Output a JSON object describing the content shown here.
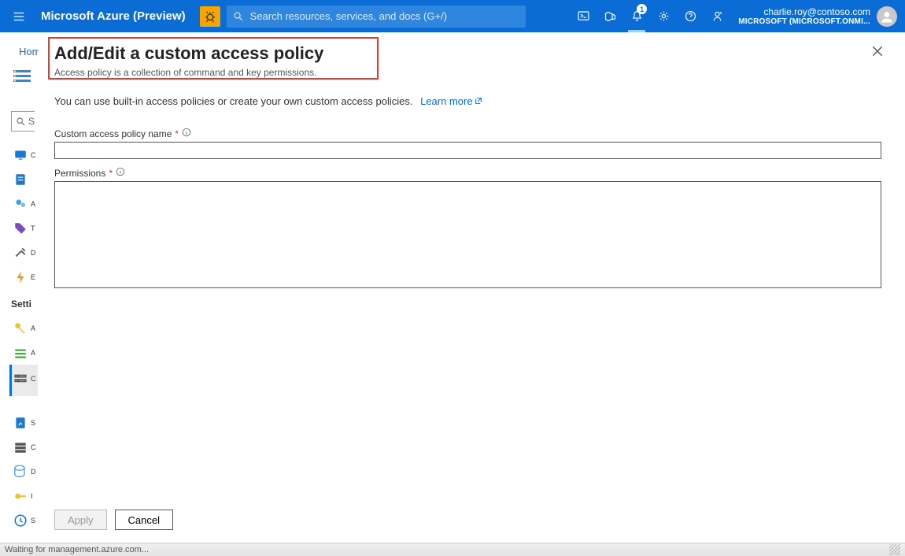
{
  "header": {
    "brand": "Microsoft Azure (Preview)",
    "search_placeholder": "Search resources, services, and docs (G+/)",
    "notification_count": "1",
    "account_email": "charlie.roy@contoso.com",
    "account_directory": "MICROSOFT (MICROSOFT.ONMI..."
  },
  "breadcrumb": {
    "home": "Hom"
  },
  "sidebar": {
    "search_prefix": "S",
    "group1": [
      "C",
      "",
      "A",
      "T",
      "D",
      "E"
    ],
    "settings_label": "Setti",
    "group2": [
      "A",
      "A",
      "C"
    ],
    "group3": [
      "S",
      "C",
      "D",
      "I",
      "S"
    ]
  },
  "panel": {
    "title": "Add/Edit a custom access policy",
    "subtitle": "Access policy is a collection of command and key permissions.",
    "intro_text": "You can use built-in access policies or create your own custom access policies.",
    "learn_more": "Learn more",
    "name_label": "Custom access policy name",
    "perm_label": "Permissions",
    "apply": "Apply",
    "cancel": "Cancel"
  },
  "status": {
    "text": "Waiting for management.azure.com..."
  }
}
